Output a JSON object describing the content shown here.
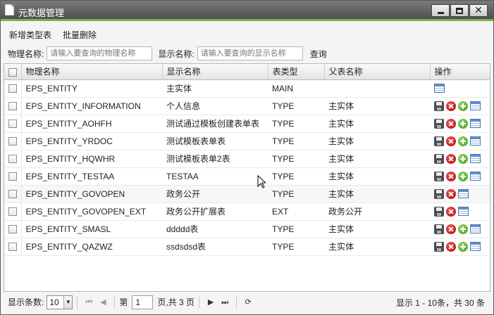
{
  "window": {
    "title": "元数据管理"
  },
  "toolbar": {
    "add_label": "新增类型表",
    "batch_delete_label": "批量删除"
  },
  "search": {
    "physical_label": "物理名称:",
    "physical_placeholder": "请输入要查询的物理名称",
    "display_label": "显示名称:",
    "display_placeholder": "请输入要查询的显示名称",
    "query_label": "查询"
  },
  "columns": {
    "physical": "物理名称",
    "display": "显示名称",
    "type": "表类型",
    "parent": "父表名称",
    "ops": "操作"
  },
  "rows": [
    {
      "physical": "EPS_ENTITY",
      "display": "主实体",
      "type": "MAIN",
      "parent": "",
      "ops": [
        "table"
      ]
    },
    {
      "physical": "EPS_ENTITY_INFORMATION",
      "display": "个人信息",
      "type": "TYPE",
      "parent": "主实体",
      "ops": [
        "save",
        "delete",
        "add",
        "table"
      ]
    },
    {
      "physical": "EPS_ENTITY_AOHFH",
      "display": "测试通过模板创建表单表",
      "type": "TYPE",
      "parent": "主实体",
      "ops": [
        "save",
        "delete",
        "add",
        "table"
      ]
    },
    {
      "physical": "EPS_ENTITY_YRDOC",
      "display": "测试模板表单表",
      "type": "TYPE",
      "parent": "主实体",
      "ops": [
        "save",
        "delete",
        "add",
        "table"
      ]
    },
    {
      "physical": "EPS_ENTITY_HQWHR",
      "display": "测试模板表单2表",
      "type": "TYPE",
      "parent": "主实体",
      "ops": [
        "save",
        "delete",
        "add",
        "table"
      ]
    },
    {
      "physical": "EPS_ENTITY_TESTAA",
      "display": "TESTAA",
      "type": "TYPE",
      "parent": "主实体",
      "ops": [
        "save",
        "delete",
        "add",
        "table"
      ]
    },
    {
      "physical": "EPS_ENTITY_GOVOPEN",
      "display": "政务公开",
      "type": "TYPE",
      "parent": "主实体",
      "ops": [
        "save",
        "delete",
        "table"
      ]
    },
    {
      "physical": "EPS_ENTITY_GOVOPEN_EXT",
      "display": "政务公开扩展表",
      "type": "EXT",
      "parent": "政务公开",
      "ops": [
        "save",
        "delete",
        "table"
      ]
    },
    {
      "physical": "EPS_ENTITY_SMASL",
      "display": "ddddd表",
      "type": "TYPE",
      "parent": "主实体",
      "ops": [
        "save",
        "delete",
        "add",
        "table"
      ]
    },
    {
      "physical": "EPS_ENTITY_QAZWZ",
      "display": "ssdsdsd表",
      "type": "TYPE",
      "parent": "主实体",
      "ops": [
        "save",
        "delete",
        "add",
        "table"
      ]
    }
  ],
  "pager": {
    "size_label": "显示条数:",
    "page_size": "10",
    "page_prefix": "第",
    "current_page": "1",
    "page_suffix": "页,共 3 页",
    "info": "显示 1 - 10条，共 30 条"
  },
  "colors": {
    "accent": "#78b640",
    "title_bar": "#5f5f5f"
  }
}
